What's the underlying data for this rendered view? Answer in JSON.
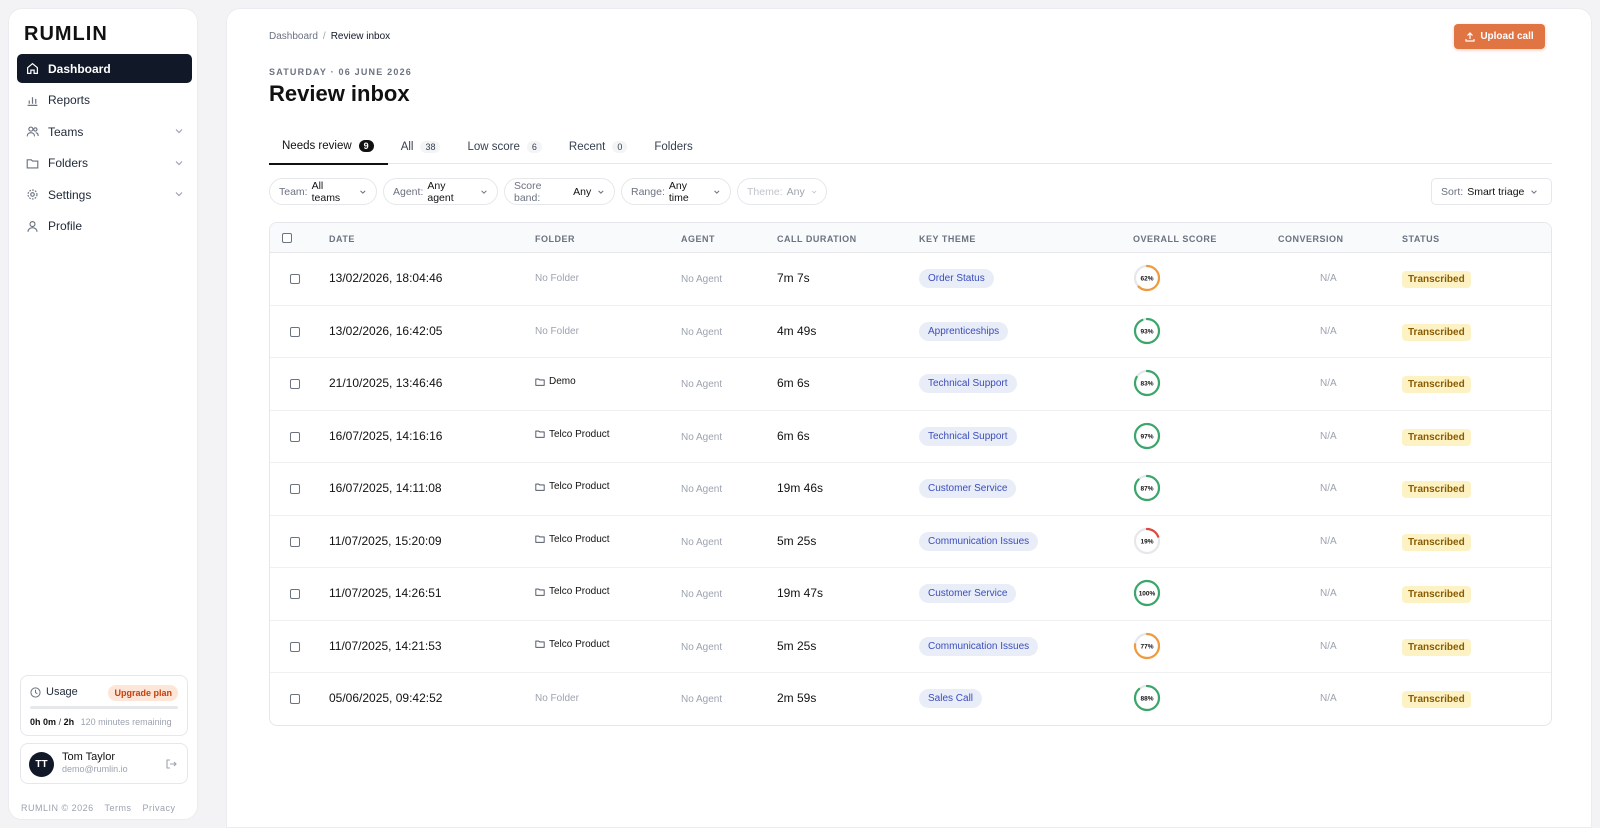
{
  "brand": "RUMLIN",
  "nav": [
    {
      "label": "Dashboard",
      "icon": "home-icon",
      "active": true
    },
    {
      "label": "Reports",
      "icon": "bar-chart-icon"
    },
    {
      "label": "Teams",
      "icon": "users-icon",
      "expandable": true
    },
    {
      "label": "Folders",
      "icon": "folder-icon",
      "expandable": true
    },
    {
      "label": "Settings",
      "icon": "gear-icon",
      "expandable": true
    },
    {
      "label": "Profile",
      "icon": "user-icon"
    }
  ],
  "usage": {
    "title": "Usage",
    "upgrade": "Upgrade plan",
    "used_h": "0h",
    "used_m": "0m",
    "sep": "/",
    "total": "2h",
    "remaining": "120 minutes remaining",
    "progress": 0
  },
  "user": {
    "initials": "TT",
    "name": "Tom Taylor",
    "email": "demo@rumlin.io"
  },
  "footer": {
    "copyright": "RUMLIN © 2026",
    "terms": "Terms",
    "privacy": "Privacy"
  },
  "breadcrumb": {
    "root": "Dashboard",
    "sep": "/",
    "current": "Review inbox"
  },
  "upload_label": "Upload call",
  "date_line": "SATURDAY · 06 JUNE 2026",
  "page_title": "Review inbox",
  "tabs": [
    {
      "label": "Needs review",
      "count": "9",
      "active": true
    },
    {
      "label": "All",
      "count": "38"
    },
    {
      "label": "Low score",
      "count": "6"
    },
    {
      "label": "Recent",
      "count": "0"
    },
    {
      "label": "Folders",
      "count": ""
    }
  ],
  "filters": {
    "team": {
      "label": "Team:",
      "value": "All teams"
    },
    "agent": {
      "label": "Agent:",
      "value": "Any agent"
    },
    "score": {
      "label": "Score band:",
      "value": "Any"
    },
    "range": {
      "label": "Range:",
      "value": "Any time"
    },
    "theme": {
      "label": "Theme:",
      "value": "Any"
    },
    "sort": {
      "label": "Sort:",
      "value": "Smart triage"
    }
  },
  "columns": {
    "date": "DATE",
    "folder": "FOLDER",
    "agent": "AGENT",
    "duration": "CALL DURATION",
    "theme": "KEY THEME",
    "score": "OVERALL SCORE",
    "conversion": "CONVERSION",
    "status": "STATUS"
  },
  "colors": {
    "score_green": "#3aa66a",
    "score_orange": "#ef9a3c",
    "score_red": "#e0463b",
    "accent": "#e07443"
  },
  "rows": [
    {
      "date": "13/02/2026, 18:04:46",
      "folder": "No Folder",
      "has_folder": false,
      "agent": "No Agent",
      "duration": "7m 7s",
      "theme": "Order Status",
      "score": 62,
      "score_label": "62%",
      "conversion": "N/A",
      "status": "Transcribed"
    },
    {
      "date": "13/02/2026, 16:42:05",
      "folder": "No Folder",
      "has_folder": false,
      "agent": "No Agent",
      "duration": "4m 49s",
      "theme": "Apprenticeships",
      "score": 93,
      "score_label": "93%",
      "conversion": "N/A",
      "status": "Transcribed"
    },
    {
      "date": "21/10/2025, 13:46:46",
      "folder": "Demo",
      "has_folder": true,
      "agent": "No Agent",
      "duration": "6m 6s",
      "theme": "Technical Support",
      "score": 83,
      "score_label": "83%",
      "conversion": "N/A",
      "status": "Transcribed"
    },
    {
      "date": "16/07/2025, 14:16:16",
      "folder": "Telco Product",
      "has_folder": true,
      "agent": "No Agent",
      "duration": "6m 6s",
      "theme": "Technical Support",
      "score": 97,
      "score_label": "97%",
      "conversion": "N/A",
      "status": "Transcribed"
    },
    {
      "date": "16/07/2025, 14:11:08",
      "folder": "Telco Product",
      "has_folder": true,
      "agent": "No Agent",
      "duration": "19m 46s",
      "theme": "Customer Service",
      "score": 87,
      "score_label": "87%",
      "conversion": "N/A",
      "status": "Transcribed"
    },
    {
      "date": "11/07/2025, 15:20:09",
      "folder": "Telco Product",
      "has_folder": true,
      "agent": "No Agent",
      "duration": "5m 25s",
      "theme": "Communication Issues",
      "score": 19,
      "score_label": "19%",
      "conversion": "N/A",
      "status": "Transcribed"
    },
    {
      "date": "11/07/2025, 14:26:51",
      "folder": "Telco Product",
      "has_folder": true,
      "agent": "No Agent",
      "duration": "19m 47s",
      "theme": "Customer Service",
      "score": 100,
      "score_label": "100%",
      "conversion": "N/A",
      "status": "Transcribed"
    },
    {
      "date": "11/07/2025, 14:21:53",
      "folder": "Telco Product",
      "has_folder": true,
      "agent": "No Agent",
      "duration": "5m 25s",
      "theme": "Communication Issues",
      "score": 77,
      "score_label": "77%",
      "conversion": "N/A",
      "status": "Transcribed"
    },
    {
      "date": "05/06/2025, 09:42:52",
      "folder": "No Folder",
      "has_folder": false,
      "agent": "No Agent",
      "duration": "2m 59s",
      "theme": "Sales Call",
      "score": 88,
      "score_label": "88%",
      "conversion": "N/A",
      "status": "Transcribed"
    }
  ]
}
